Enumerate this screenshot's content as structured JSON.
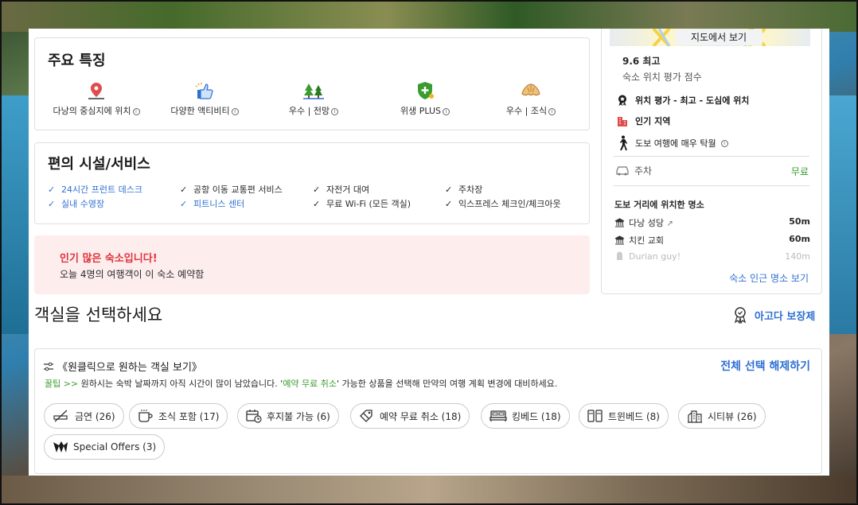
{
  "features": {
    "title": "주요 특징",
    "items": [
      {
        "label": "다낭의 중심지에 위치",
        "icon": "map-pin-icon"
      },
      {
        "label": "다양한 액티비티",
        "icon": "thumbs-up-icon"
      },
      {
        "label": "우수 | 전망",
        "icon": "trees-icon"
      },
      {
        "label": "위생 PLUS",
        "icon": "shield-plus-icon"
      },
      {
        "label": "우수 | 조식",
        "icon": "croissant-icon"
      }
    ]
  },
  "amenities": {
    "title": "편의 시설/서비스",
    "items": [
      {
        "label": "24시간 프런트 데스크",
        "highlight": true
      },
      {
        "label": "공항 이동 교통편 서비스",
        "highlight": false
      },
      {
        "label": "자전거 대여",
        "highlight": false
      },
      {
        "label": "주차장",
        "highlight": false
      },
      {
        "label": "실내 수영장",
        "highlight": true
      },
      {
        "label": "피트니스 센터",
        "highlight": true
      },
      {
        "label": "무료 Wi-Fi (모든 객실)",
        "highlight": false
      },
      {
        "label": "익스프레스 체크인/체크아웃",
        "highlight": false
      }
    ]
  },
  "popular": {
    "title": "인기 많은 숙소입니다!",
    "subtitle": "오늘 4명의 여행객이 이 숙소 예약함"
  },
  "rooms": {
    "heading": "객실을 선택하세요",
    "guarantee": "아고다 보장제"
  },
  "filter": {
    "heading": "《원클릭으로 원하는 객실 보기》",
    "clear_all": "전체 선택 해제하기",
    "tip_prefix": "꿀팁 >>",
    "tip_text_1": " 원하시는 숙박 날짜까지 아직 시간이 많이 남았습니다. '",
    "tip_highlight": "예약 무료 취소",
    "tip_text_2": "' 가능한 상품을 선택해 만약의 여행 계획 변경에 대비하세요.",
    "chips": [
      {
        "label": "금연 (26)",
        "icon": "no-smoking-icon"
      },
      {
        "label": "조식 포함 (17)",
        "icon": "coffee-cup-icon"
      },
      {
        "label": "후지불 가능 (6)",
        "icon": "calendar-clock-icon"
      },
      {
        "label": "예약 무료 취소 (18)",
        "icon": "free-cancel-icon"
      },
      {
        "label": "킹베드 (18)",
        "icon": "king-bed-icon"
      },
      {
        "label": "트윈베드 (8)",
        "icon": "twin-bed-icon"
      },
      {
        "label": "시티뷰 (26)",
        "icon": "city-view-icon"
      },
      {
        "label": "Special Offers (3)",
        "icon": "special-offers-icon"
      }
    ]
  },
  "location": {
    "map_button": "지도에서 보기",
    "score": "9.6 최고",
    "score_sub": "숙소 위치 평가 점수",
    "rows": [
      {
        "label": "위치 평가 - 최고 - 도심에 위치",
        "icon": "award-icon"
      },
      {
        "label": "인기 지역",
        "icon": "building-icon"
      },
      {
        "label": "도보 여행에 매우 탁월",
        "icon": "walking-icon"
      }
    ],
    "parking_label": "주차",
    "parking_value": "무료",
    "nearby_title": "도보 거리에 위치한 명소",
    "nearby": [
      {
        "name": "다낭 성당",
        "distance": "50m"
      },
      {
        "name": "치킨 교회",
        "distance": "60m"
      },
      {
        "name": "Durian guy!",
        "distance": "140m"
      }
    ],
    "nearby_link": "숙소 인근 명소 보기"
  },
  "colors": {
    "accent_blue": "#2f6fd3",
    "alert_red": "#e0323a",
    "alert_bg": "#fdeeed",
    "green": "#3a9c2e"
  }
}
